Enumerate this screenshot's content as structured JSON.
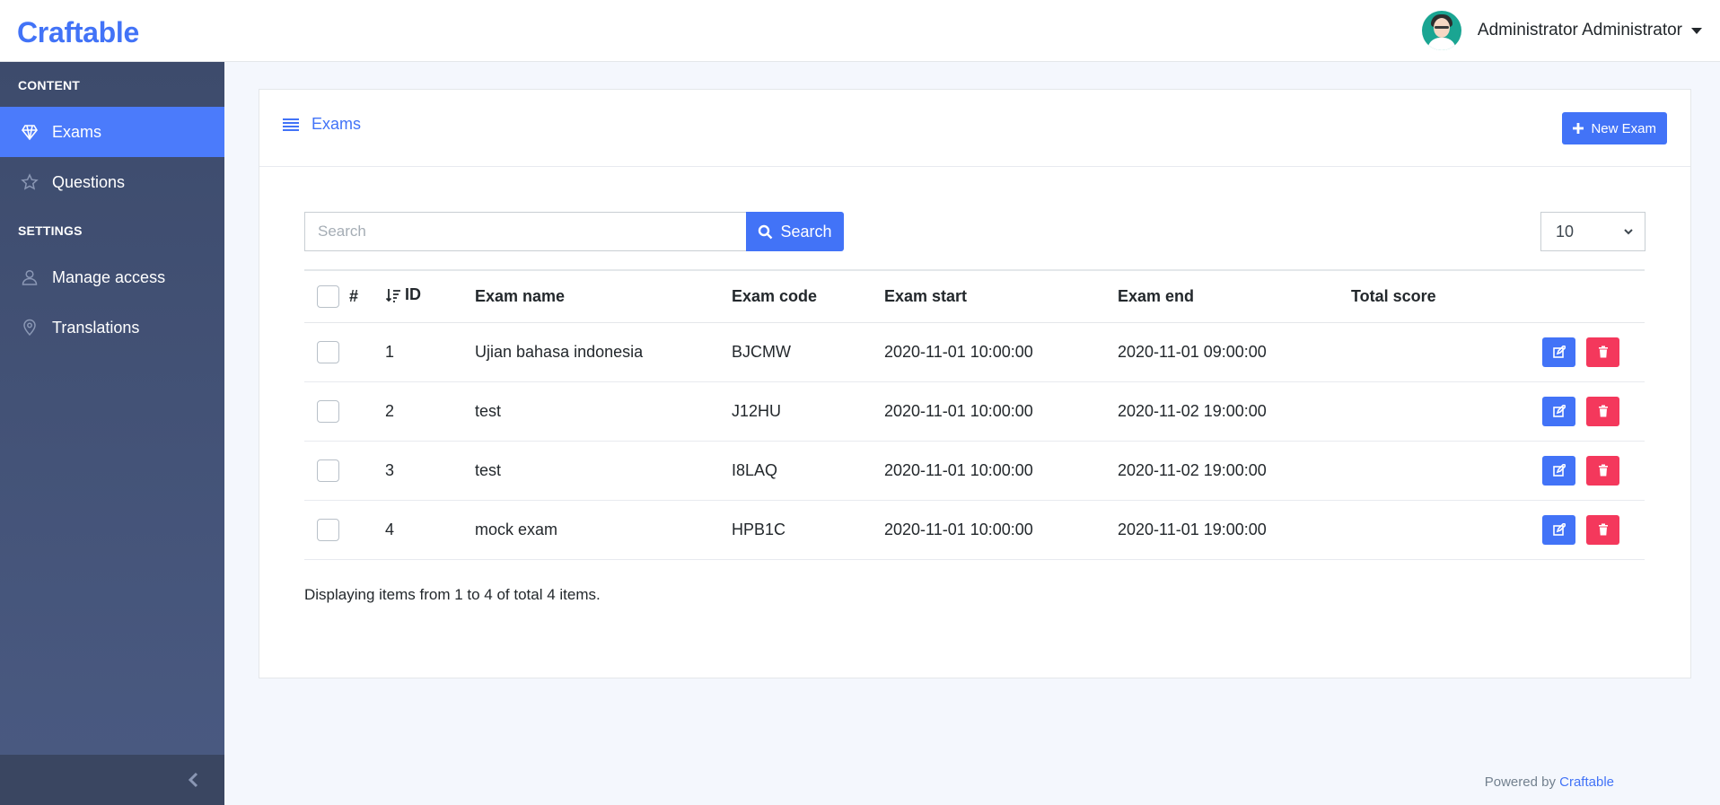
{
  "brand": "Craftable",
  "user": {
    "name": "Administrator Administrator",
    "avatar_icon": "avatar-icon"
  },
  "sidebar": {
    "sections": [
      {
        "title": "CONTENT"
      },
      {
        "title": "SETTINGS"
      }
    ],
    "items": [
      {
        "label": "Exams",
        "icon": "diamond-icon",
        "active": true
      },
      {
        "label": "Questions",
        "icon": "star-icon",
        "active": false
      },
      {
        "label": "Manage access",
        "icon": "user-icon",
        "active": false
      },
      {
        "label": "Translations",
        "icon": "location-pin-icon",
        "active": false
      }
    ]
  },
  "card": {
    "title": "Exams",
    "new_button": "New Exam"
  },
  "search": {
    "placeholder": "Search",
    "button": "Search"
  },
  "per_page": "10",
  "table": {
    "headers": {
      "num": "#",
      "id": "ID",
      "name": "Exam name",
      "code": "Exam code",
      "start": "Exam start",
      "end": "Exam end",
      "score": "Total score"
    },
    "rows": [
      {
        "id": "1",
        "name": "Ujian bahasa indonesia",
        "code": "BJCMW",
        "start": "2020-11-01 10:00:00",
        "end": "2020-11-01 09:00:00",
        "score": ""
      },
      {
        "id": "2",
        "name": "test",
        "code": "J12HU",
        "start": "2020-11-01 10:00:00",
        "end": "2020-11-02 19:00:00",
        "score": ""
      },
      {
        "id": "3",
        "name": "test",
        "code": "I8LAQ",
        "start": "2020-11-01 10:00:00",
        "end": "2020-11-02 19:00:00",
        "score": ""
      },
      {
        "id": "4",
        "name": "mock exam",
        "code": "HPB1C",
        "start": "2020-11-01 10:00:00",
        "end": "2020-11-01 19:00:00",
        "score": ""
      }
    ]
  },
  "summary": "Displaying items from 1 to 4 of total 4 items.",
  "footer": {
    "prefix": "Powered by",
    "link": "Craftable"
  },
  "colors": {
    "primary": "#4273f7",
    "danger": "#f4385c",
    "sidebar": "#3d4b6c"
  }
}
